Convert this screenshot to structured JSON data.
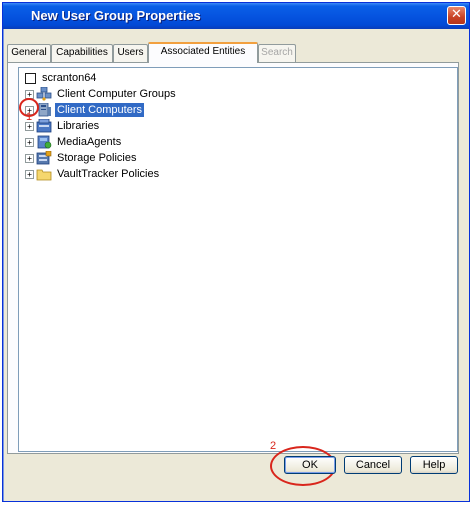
{
  "window": {
    "title": "New User Group Properties",
    "close_glyph": "✕"
  },
  "tabs": [
    {
      "label": "General",
      "state": "normal"
    },
    {
      "label": "Capabilities",
      "state": "normal"
    },
    {
      "label": "Users",
      "state": "normal"
    },
    {
      "label": "Associated Entities",
      "state": "active"
    },
    {
      "label": "Search",
      "state": "disabled"
    }
  ],
  "tree": {
    "root": {
      "label": "scranton64",
      "checked": false
    },
    "items": [
      {
        "label": "Client Computer Groups",
        "icon": "computer-group-icon",
        "expander": "+",
        "selected": false
      },
      {
        "label": "Client Computers",
        "icon": "client-computers-icon",
        "expander": "+",
        "selected": true
      },
      {
        "label": "Libraries",
        "icon": "library-icon",
        "expander": "+",
        "selected": false
      },
      {
        "label": "MediaAgents",
        "icon": "media-agent-icon",
        "expander": "+",
        "selected": false
      },
      {
        "label": "Storage Policies",
        "icon": "storage-policy-icon",
        "expander": "+",
        "selected": false
      },
      {
        "label": "VaultTracker Policies",
        "icon": "folder-icon",
        "expander": "+",
        "selected": false
      }
    ]
  },
  "annotations": {
    "step1": "1",
    "step2": "2",
    "color": "#d9261c"
  },
  "buttons": {
    "ok": "OK",
    "cancel": "Cancel",
    "help": "Help"
  },
  "colors": {
    "selection": "#316ac5",
    "titlebar": "#0654e0",
    "dialog_bg": "#ece9d8"
  }
}
